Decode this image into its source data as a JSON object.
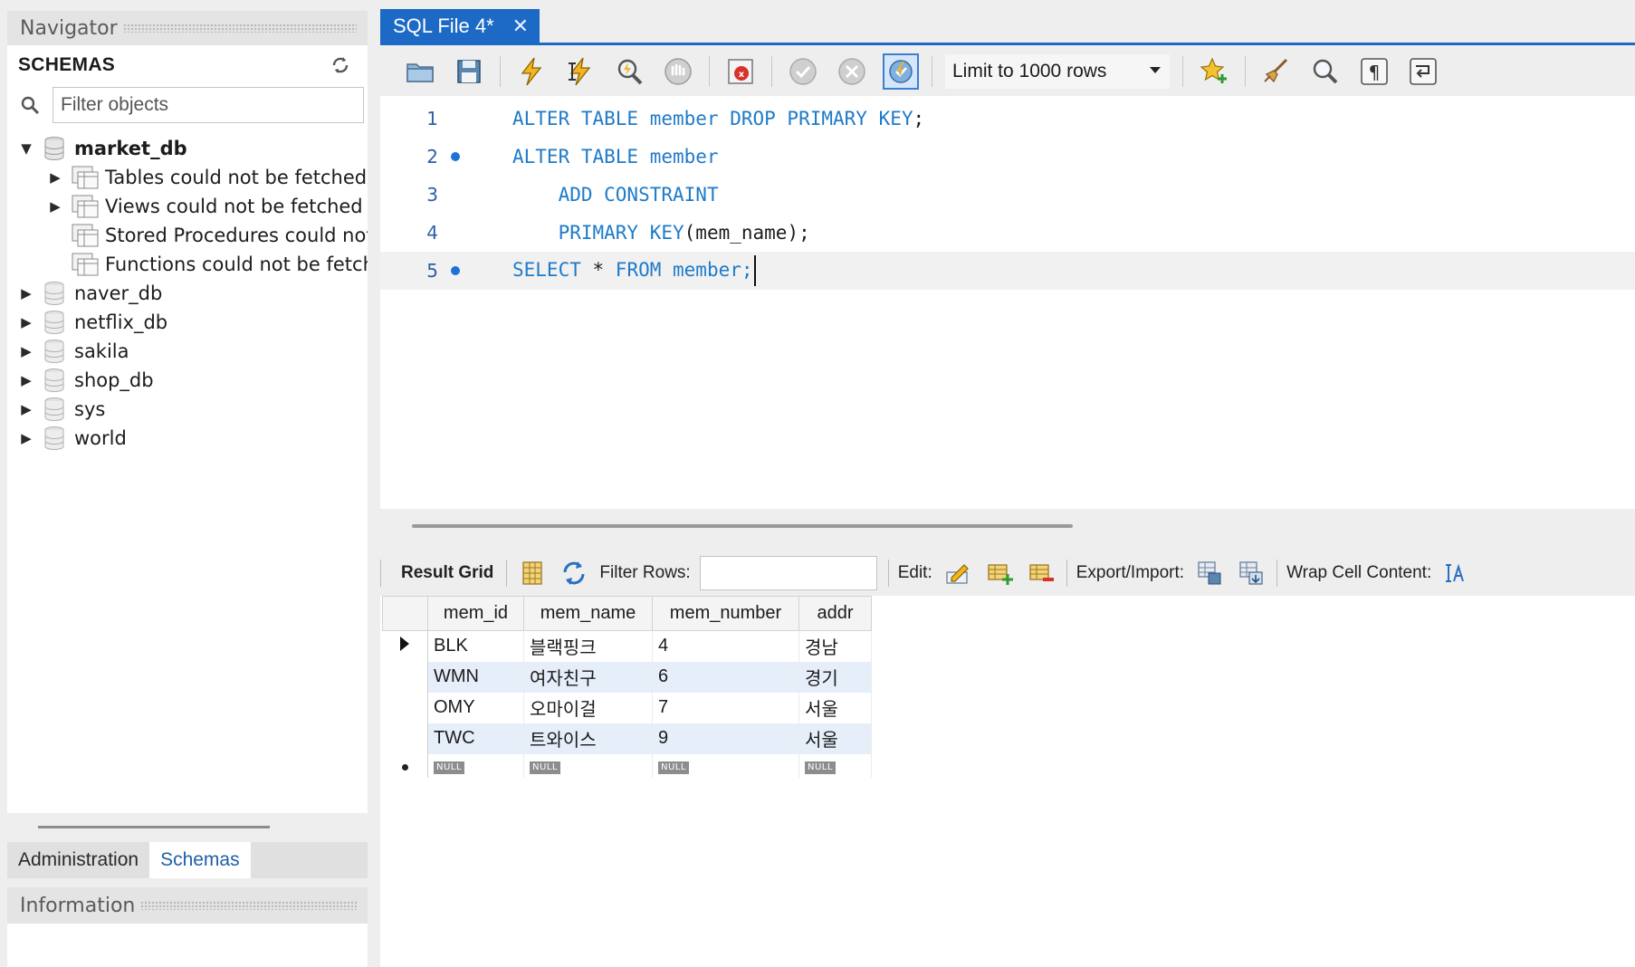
{
  "navigator": {
    "title": "Navigator",
    "schemas_label": "SCHEMAS",
    "filter_placeholder": "Filter objects",
    "tree": {
      "market_db": {
        "name": "market_db",
        "children": [
          "Tables could not be fetched",
          "Views could not be fetched",
          "Stored Procedures could not",
          "Functions could not be fetch"
        ]
      },
      "others": [
        "naver_db",
        "netflix_db",
        "sakila",
        "shop_db",
        "sys",
        "world"
      ]
    },
    "bottom_tabs": [
      "Administration",
      "Schemas"
    ],
    "active_bottom_tab": "Schemas",
    "information_title": "Information"
  },
  "editor": {
    "tab_title": "SQL File 4*",
    "limit_select": "Limit to 1000 rows",
    "lines": [
      {
        "num": "1",
        "marker": false,
        "current": false
      },
      {
        "num": "2",
        "marker": true,
        "current": false
      },
      {
        "num": "3",
        "marker": false,
        "current": false
      },
      {
        "num": "4",
        "marker": false,
        "current": false
      },
      {
        "num": "5",
        "marker": true,
        "current": true
      }
    ],
    "code": {
      "l1": {
        "kw": "ALTER TABLE member DROP PRIMARY KEY",
        "rest": ";"
      },
      "l2": {
        "kw": "ALTER TABLE member"
      },
      "l3": {
        "indent": "    ",
        "kw": "ADD CONSTRAINT"
      },
      "l4": {
        "indent": "    ",
        "kw": "PRIMARY KEY",
        "rest": "(mem_name);"
      },
      "l5": {
        "kw1": "SELECT",
        "mid": " * ",
        "kw2": "FROM member",
        "rest": ";"
      }
    }
  },
  "results": {
    "toolbar": {
      "result_grid": "Result Grid",
      "filter_rows": "Filter Rows:",
      "edit": "Edit:",
      "export_import": "Export/Import:",
      "wrap_cell": "Wrap Cell Content:"
    },
    "columns": [
      "mem_id",
      "mem_name",
      "mem_number",
      "addr"
    ],
    "rows": [
      [
        "BLK",
        "블랙핑크",
        "4",
        "경남"
      ],
      [
        "WMN",
        "여자친구",
        "6",
        "경기"
      ],
      [
        "OMY",
        "오마이걸",
        "7",
        "서울"
      ],
      [
        "TWC",
        "트와이스",
        "9",
        "서울"
      ]
    ],
    "null_label": "NULL"
  },
  "colors": {
    "accent": "#1c6ac5",
    "keyword": "#1f7bc8",
    "alt_row": "#e6eefa"
  }
}
